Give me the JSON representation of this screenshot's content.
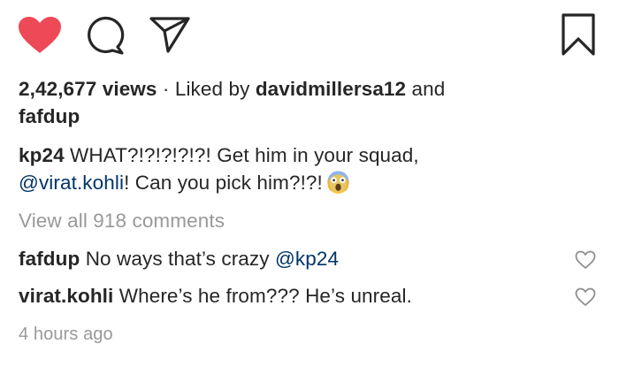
{
  "post": {
    "views": "2,42,677 views",
    "separator": "·",
    "liked_by_prefix": "Liked by",
    "liked_by_user_1": "davidmillersa12",
    "liked_by_and": "and",
    "liked_by_user_2": "fafdup",
    "caption": {
      "username": "kp24",
      "text_line1": "WHAT?!?!?!?!?! Get him in your squad,",
      "mention": "@virat.kohli",
      "text_line2": "! Can you pick him?!?!",
      "emoji": "screaming-face-emoji"
    },
    "view_all_comments": "View all 918 comments",
    "comments": [
      {
        "username": "fafdup",
        "text": "No ways that’s crazy",
        "mention": "@kp24"
      },
      {
        "username": "virat.kohli",
        "text": "Where’s he from??? He’s unreal."
      }
    ],
    "timestamp": "4 hours ago"
  },
  "icons": {
    "like": "heart-filled-icon",
    "comment": "comment-bubble-icon",
    "share": "paper-plane-icon",
    "save": "bookmark-icon",
    "comment_like": "heart-outline-icon"
  },
  "colors": {
    "like": "#ed4956",
    "text": "#262626",
    "muted": "#999999",
    "mention": "#003569"
  }
}
